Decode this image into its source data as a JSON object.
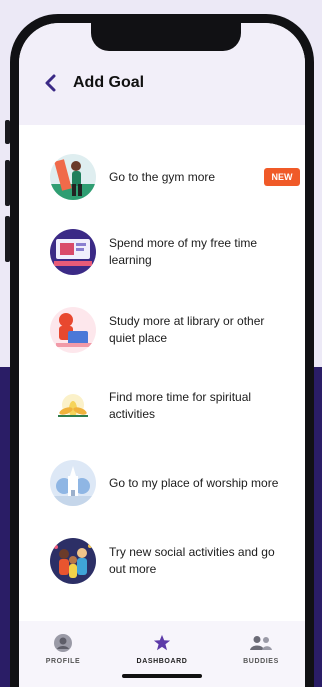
{
  "header": {
    "title": "Add Goal"
  },
  "goals": [
    {
      "label": "Go to the gym more",
      "badge": "NEW",
      "icon": "gym-illustration"
    },
    {
      "label": "Spend more of my free time learning",
      "icon": "learning-illustration"
    },
    {
      "label": "Study more at library or other quiet place",
      "icon": "study-illustration"
    },
    {
      "label": "Find more time for spiritual activities",
      "icon": "lotus-illustration"
    },
    {
      "label": "Go to my place of worship more",
      "icon": "worship-illustration"
    },
    {
      "label": "Try new social activities and go out more",
      "icon": "social-illustration"
    }
  ],
  "tabs": [
    {
      "label": "PROFILE",
      "icon": "profile-icon"
    },
    {
      "label": "DASHBOARD",
      "icon": "star-icon",
      "active": true
    },
    {
      "label": "BUDDIES",
      "icon": "buddies-icon"
    }
  ],
  "colors": {
    "accent": "#3b2a86",
    "badge": "#f05a28",
    "header_bg": "#f2eff9",
    "page_bg_dark": "#2a1d66"
  }
}
